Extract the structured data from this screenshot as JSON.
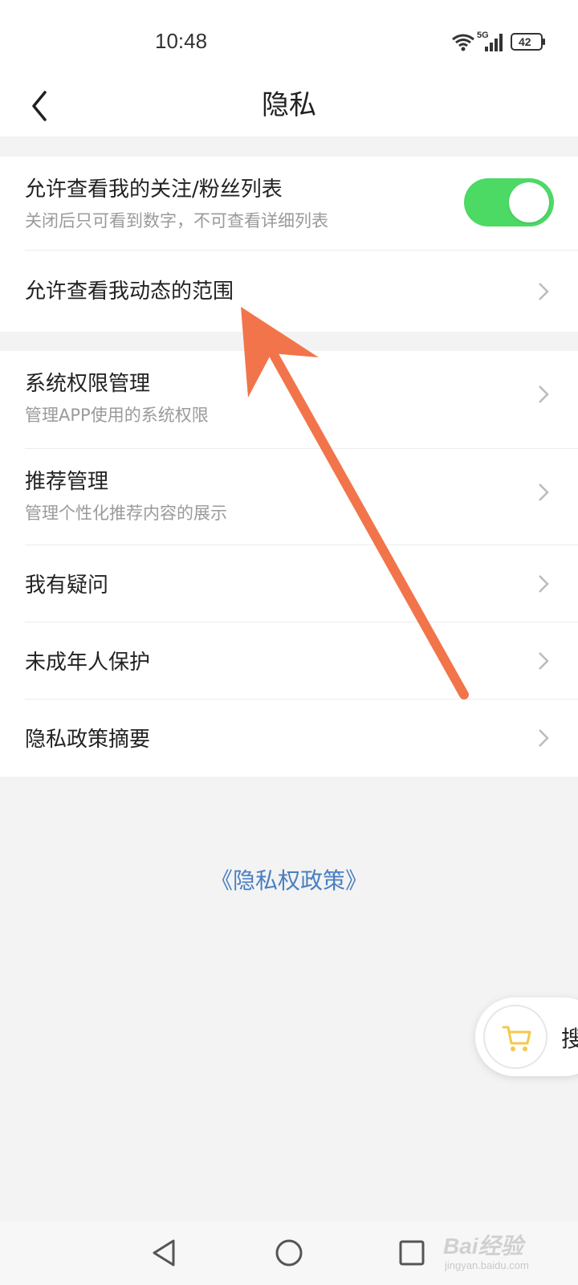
{
  "status_bar": {
    "time": "10:48",
    "network": "5G",
    "battery": "42"
  },
  "header": {
    "title": "隐私",
    "back_icon": "chevron-left-icon"
  },
  "groups": [
    {
      "items": [
        {
          "title": "允许查看我的关注/粉丝列表",
          "subtitle": "关闭后只可看到数字，不可查看详细列表",
          "control": "toggle",
          "toggle_on": true
        },
        {
          "title": "允许查看我动态的范围",
          "control": "chevron"
        }
      ]
    },
    {
      "items": [
        {
          "title": "系统权限管理",
          "subtitle": "管理APP使用的系统权限",
          "control": "chevron"
        },
        {
          "title": "推荐管理",
          "subtitle": "管理个性化推荐内容的展示",
          "control": "chevron"
        },
        {
          "title": "我有疑问",
          "control": "chevron"
        },
        {
          "title": "未成年人保护",
          "control": "chevron"
        },
        {
          "title": "隐私政策摘要",
          "control": "chevron"
        }
      ]
    }
  ],
  "footer_link": "《隐私权政策》",
  "floating_button": {
    "icon": "shopping-cart-icon",
    "label": "搜"
  },
  "system_nav": [
    "back-triangle-icon",
    "home-circle-icon",
    "recents-square-icon"
  ],
  "watermark": {
    "main": "Bai经验",
    "sub": "jingyan.baidu.com"
  },
  "colors": {
    "toggle_on": "#4cd964",
    "link": "#4a7fc1",
    "annotation_arrow": "#f2744a",
    "cart_icon": "#f5c84c"
  }
}
